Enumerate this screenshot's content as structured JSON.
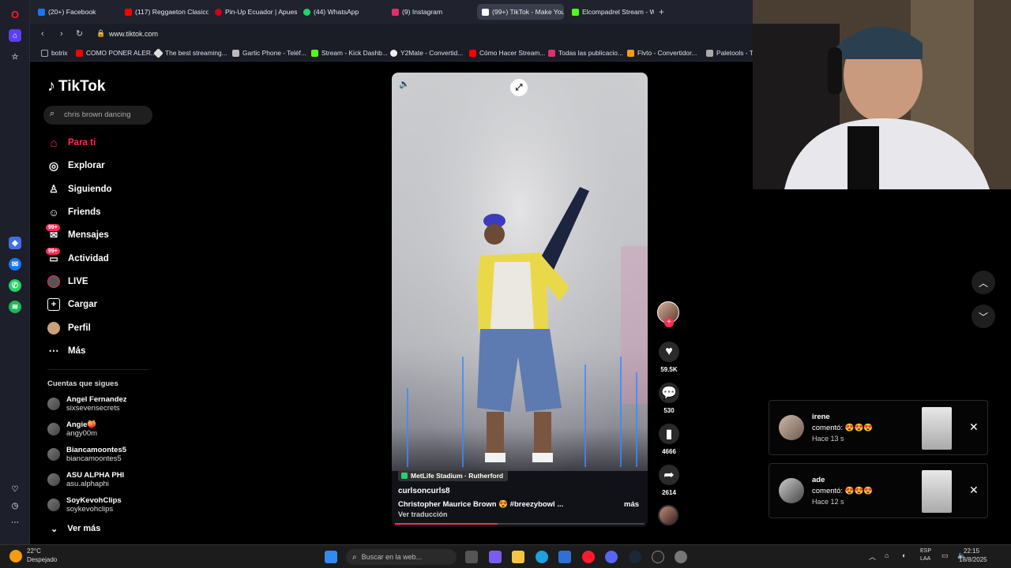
{
  "browser": {
    "tabs": [
      {
        "label": "(20+) Facebook",
        "color": "#1877f2"
      },
      {
        "label": "(117) Reggaeton Clasico Vi",
        "color": "#ff0000"
      },
      {
        "label": "Pin-Up Ecuador | Apuesta",
        "color": "#d0021b"
      },
      {
        "label": "(44) WhatsApp",
        "color": "#25d366"
      },
      {
        "label": "(9) Instagram",
        "color": "#e1306c"
      },
      {
        "label": "(99+) TikTok - Make Your D",
        "color": "#ffffff"
      },
      {
        "label": "Elcompadrel Stream - Wa",
        "color": "#53fc18"
      }
    ],
    "url": "www.tiktok.com",
    "bookmarks": [
      {
        "label": "botrix"
      },
      {
        "label": "COMO PONER ALER..."
      },
      {
        "label": "The best streaming..."
      },
      {
        "label": "Gartic Phone - Teléf..."
      },
      {
        "label": "Stream - Kick Dashb..."
      },
      {
        "label": "Y2Mate - Convertid..."
      },
      {
        "label": "Cómo Hacer Stream..."
      },
      {
        "label": "Todas las publicacio..."
      },
      {
        "label": "Flvto - Convertidor..."
      },
      {
        "label": "Paletools - T"
      }
    ]
  },
  "tiktok": {
    "logo": "TikTok",
    "search_value": "chris brown dancing",
    "nav": [
      {
        "label": "Para ti",
        "icon": "home-icon",
        "active": true
      },
      {
        "label": "Explorar",
        "icon": "compass-icon"
      },
      {
        "label": "Siguiendo",
        "icon": "following-icon"
      },
      {
        "label": "Friends",
        "icon": "friends-icon"
      },
      {
        "label": "Mensajes",
        "icon": "message-icon",
        "badge": "99+"
      },
      {
        "label": "Actividad",
        "icon": "inbox-icon",
        "badge": "99+"
      },
      {
        "label": "LIVE",
        "icon": "live-icon"
      },
      {
        "label": "Cargar",
        "icon": "upload-icon"
      },
      {
        "label": "Perfil",
        "icon": "profile-icon"
      },
      {
        "label": "Más",
        "icon": "more-icon"
      }
    ],
    "following_title": "Cuentas que sigues",
    "following": [
      {
        "name": "Angel Fernandez",
        "handle": "sixsevensecrets"
      },
      {
        "name": "Angie🍑",
        "handle": "angy00m"
      },
      {
        "name": "Biancamoontes5",
        "handle": "biancamoontes5"
      },
      {
        "name": "ASU ALPHA PHI",
        "handle": "asu.alphaphi"
      },
      {
        "name": "SoyKevohClips",
        "handle": "soykevohclips"
      }
    ],
    "see_more": "Ver más",
    "video": {
      "location": "MetLife Stadium · Rutherford",
      "author": "curlsoncurls8",
      "caption": "Christopher Maurice Brown 😍 #breezybowl ...",
      "more": "más",
      "translate": "Ver traducción",
      "progress": 0.41
    },
    "actions": {
      "likes": "59.5K",
      "comments": "530",
      "saves": "4666",
      "shares": "2614"
    },
    "notifications": [
      {
        "user": "irene",
        "text": "comentó: 😍😍😍",
        "time": "Hace 13 s"
      },
      {
        "user": "ade",
        "text": "comentó: 😍😍😍",
        "time": "Hace 12 s"
      }
    ]
  },
  "taskbar": {
    "weather_temp": "22°C",
    "weather_desc": "Despejado",
    "search_placeholder": "Buscar en la web...",
    "lang": "ESP",
    "lang2": "LAA",
    "time": "22:15",
    "date": "18/8/2025"
  },
  "colors": {
    "accent": "#fe2c55",
    "bg": "#000000",
    "chrome": "#20222e"
  }
}
